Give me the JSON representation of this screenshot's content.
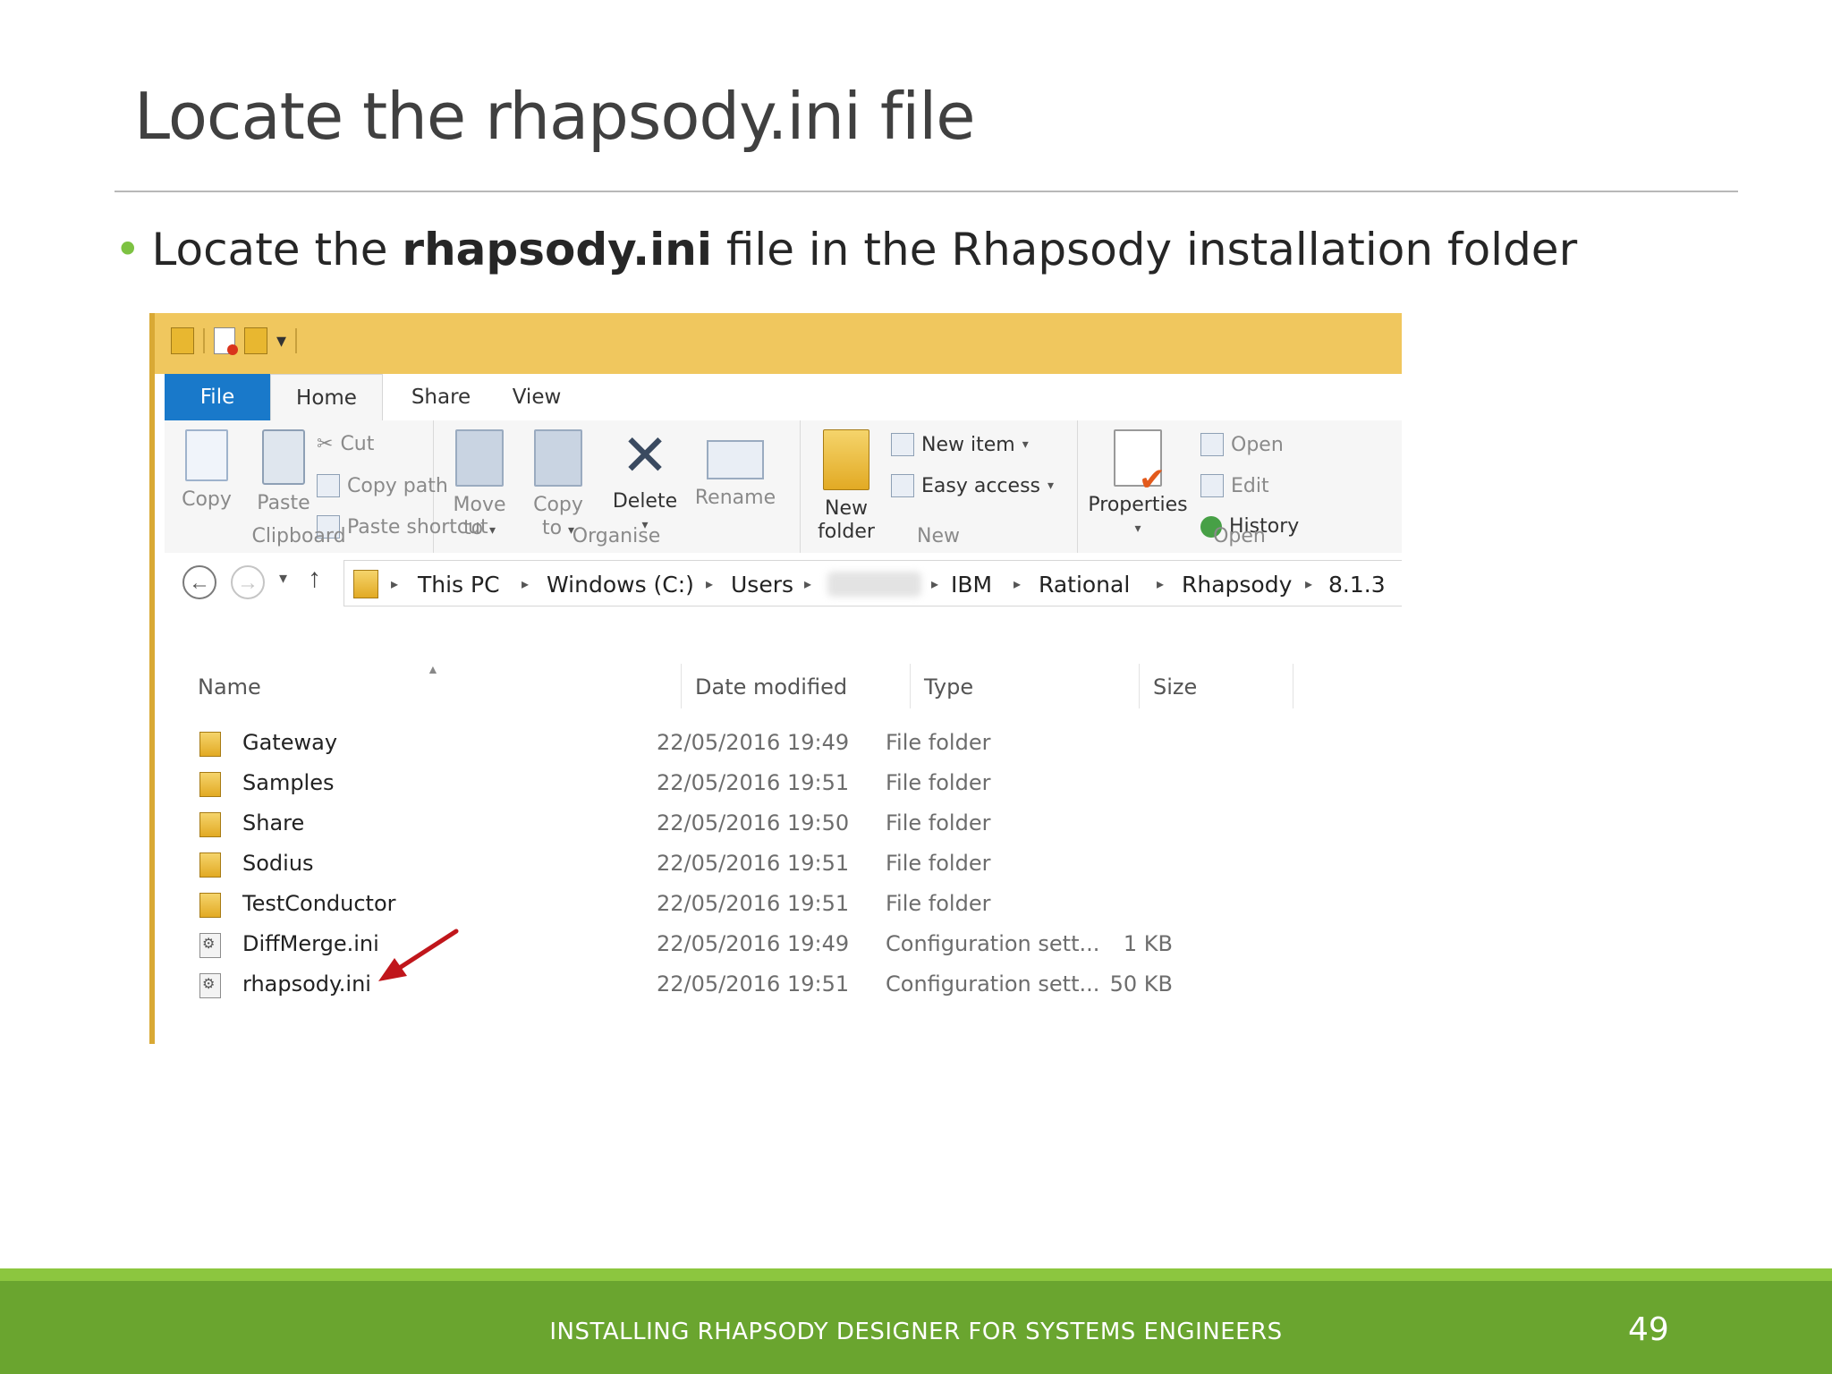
{
  "slide": {
    "title": "Locate the rhapsody.ini file",
    "bullet_pre": "Locate the ",
    "bullet_bold": "rhapsody.ini",
    "bullet_post": " file in the Rhapsody installation folder",
    "footer": "INSTALLING RHAPSODY DESIGNER FOR SYSTEMS ENGINEERS",
    "page_number": "49"
  },
  "explorer": {
    "tabs": [
      "File",
      "Home",
      "Share",
      "View"
    ],
    "ribbon": {
      "clipboard": {
        "label": "Clipboard",
        "copy": "Copy",
        "paste": "Paste",
        "cut": "Cut",
        "copy_path": "Copy path",
        "paste_shortcut": "Paste shortcut"
      },
      "organise": {
        "label": "Organise",
        "move_to_1": "Move",
        "move_to_2": "to",
        "copy_to_1": "Copy",
        "copy_to_2": "to",
        "delete": "Delete",
        "rename": "Rename"
      },
      "new": {
        "label": "New",
        "new_folder_1": "New",
        "new_folder_2": "folder",
        "new_item": "New item",
        "easy_access": "Easy access"
      },
      "open": {
        "label": "Open",
        "properties": "Properties",
        "open": "Open",
        "edit": "Edit",
        "history": "History"
      }
    },
    "breadcrumb": [
      "This PC",
      "Windows (C:)",
      "Users",
      "IBM",
      "Rational",
      "Rhapsody",
      "8.1.3"
    ],
    "columns": {
      "name": "Name",
      "date": "Date modified",
      "type": "Type",
      "size": "Size"
    },
    "files": [
      {
        "name": "Gateway",
        "date": "22/05/2016 19:49",
        "type": "File folder",
        "size": "",
        "icon": "folder-icon"
      },
      {
        "name": "Samples",
        "date": "22/05/2016 19:51",
        "type": "File folder",
        "size": "",
        "icon": "folder-icon"
      },
      {
        "name": "Share",
        "date": "22/05/2016 19:50",
        "type": "File folder",
        "size": "",
        "icon": "folder-icon"
      },
      {
        "name": "Sodius",
        "date": "22/05/2016 19:51",
        "type": "File folder",
        "size": "",
        "icon": "folder-icon"
      },
      {
        "name": "TestConductor",
        "date": "22/05/2016 19:51",
        "type": "File folder",
        "size": "",
        "icon": "folder-icon"
      },
      {
        "name": "DiffMerge.ini",
        "date": "22/05/2016 19:49",
        "type": "Configuration sett...",
        "size": "1 KB",
        "icon": "ini-file-icon"
      },
      {
        "name": "rhapsody.ini",
        "date": "22/05/2016 19:51",
        "type": "Configuration sett...",
        "size": "50 KB",
        "icon": "ini-file-icon"
      }
    ]
  },
  "colors": {
    "accent_green": "#6aa52f",
    "light_green": "#8cc63f",
    "file_tab_blue": "#1979ca",
    "titlebar_yellow": "#f0c75e",
    "arrow_red": "#c0161b"
  }
}
